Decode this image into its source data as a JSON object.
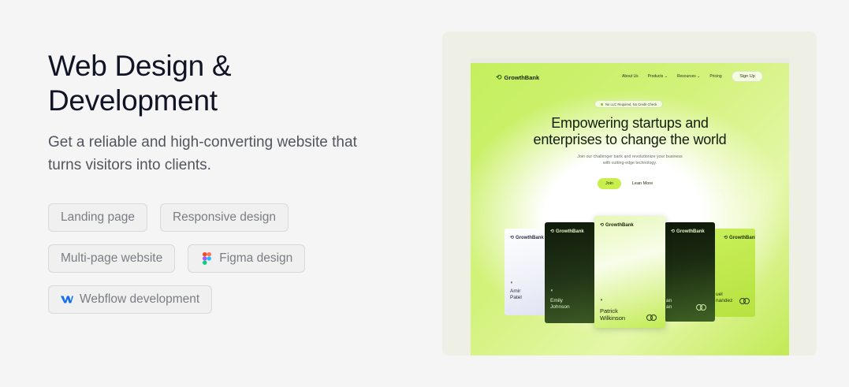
{
  "heading": {
    "line1": "Web Design &",
    "line2": "Development"
  },
  "subtitle": {
    "line1": "Get a reliable and high-converting website that",
    "line2": "turns visitors into clients."
  },
  "tags": {
    "landing": "Landing page",
    "responsive": "Responsive design",
    "multipage": "Multi-page website",
    "figma": "Figma design",
    "webflow": "Webflow development"
  },
  "mockup": {
    "brand": "GrowthBank",
    "nav": {
      "about": "About Us",
      "products": "Products ⌄",
      "resources": "Resources ⌄",
      "pricing": "Pricing",
      "signup": "Sign Up"
    },
    "badge": "No LLC Required, No Credit Check",
    "hero_title": {
      "line1": "Empowering startups and",
      "line2": "enterprises to change the world"
    },
    "hero_sub": {
      "line1": "Join our challenger bank and revolutionize your business",
      "line2": "with cutting-edge technology."
    },
    "join": "Join",
    "learn_more": "Lean More",
    "cards": {
      "amir": {
        "first": "Amir",
        "last": "Patel"
      },
      "emily": {
        "first": "Emily",
        "last": "Johnson"
      },
      "patrick": {
        "first": "Patrick",
        "last": "Wilkinson"
      },
      "dark2": {
        "first": "an",
        "last": "an"
      },
      "fernandez": {
        "first": "uel",
        "last": "nandez"
      }
    }
  },
  "colors": {
    "accent": "#c8ef4e",
    "text": "#111424",
    "tag_bg": "#f0f0f0",
    "webflow_blue": "#146ef5"
  },
  "icons": [
    "figma-icon",
    "webflow-icon",
    "growthbank-logo-icon",
    "nfc-icon",
    "mastercard-icon"
  ]
}
